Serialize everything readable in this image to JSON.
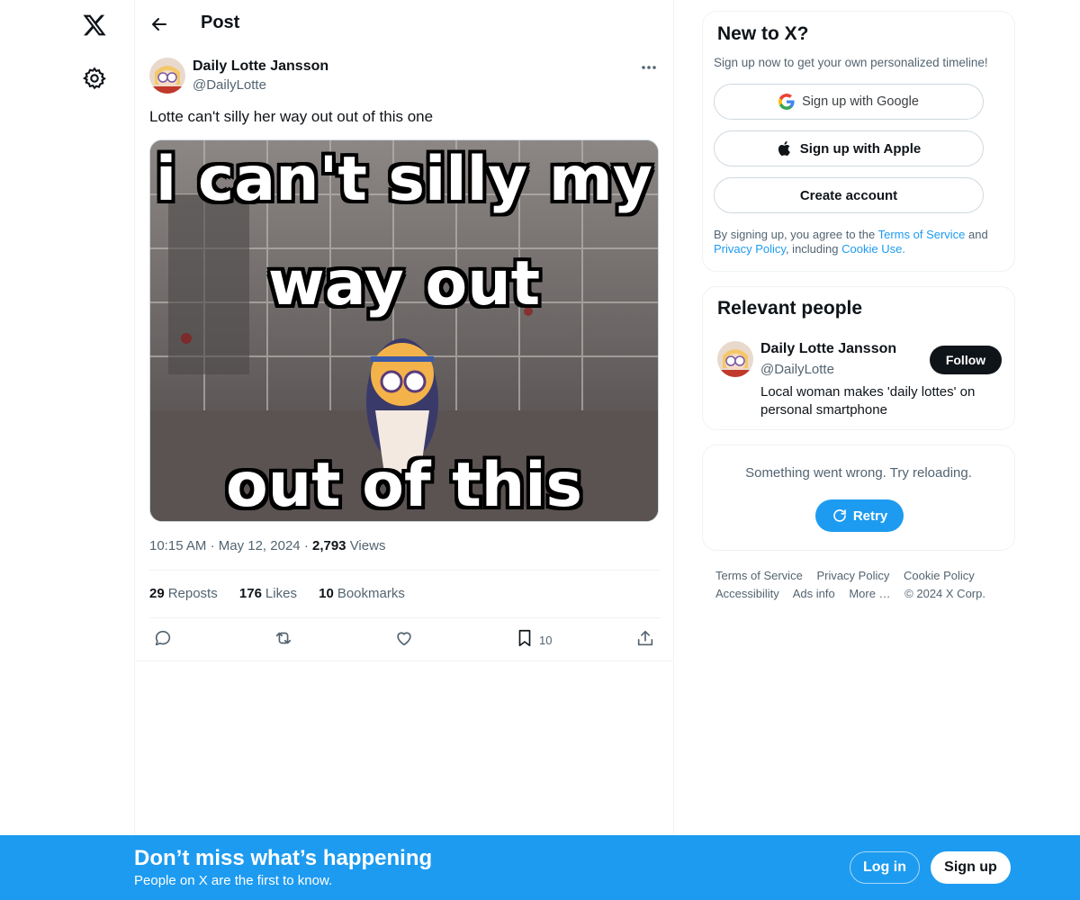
{
  "nav": {
    "logo_icon": "x-logo-icon",
    "settings_icon": "gear-icon"
  },
  "header": {
    "back_icon": "arrow-left-icon",
    "title": "Post"
  },
  "post": {
    "author_name": "Daily Lotte Jansson",
    "author_handle": "@DailyLotte",
    "text": "Lotte can't silly her way out out of this one",
    "media": {
      "caption_line1": "i can't silly my",
      "caption_line2": "way out",
      "caption_line3": "out of this one."
    },
    "time": "10:15 AM",
    "date": "May 12, 2024",
    "views_count": "2,793",
    "views_label": "Views",
    "reposts_count": "29",
    "reposts_label": "Reposts",
    "likes_count": "176",
    "likes_label": "Likes",
    "bookmarks_count": "10",
    "bookmarks_label": "Bookmarks",
    "action_bookmark_count": "10"
  },
  "signup_card": {
    "title": "New to X?",
    "subtitle": "Sign up now to get your own personalized timeline!",
    "google_label": "Sign up with Google",
    "apple_label": "Sign up with Apple",
    "create_label": "Create account",
    "legal_prefix": "By signing up, you agree to the ",
    "terms_link": "Terms of Service",
    "legal_and": " and ",
    "privacy_link": "Privacy Policy",
    "legal_including": ", including ",
    "cookie_link": "Cookie Use."
  },
  "relevant": {
    "title": "Relevant people",
    "name": "Daily Lotte Jansson",
    "handle": "@DailyLotte",
    "follow_label": "Follow",
    "bio": "Local woman makes 'daily lottes' on personal smartphone"
  },
  "trends_error": {
    "message": "Something went wrong. Try reloading.",
    "retry_label": "Retry"
  },
  "footer": {
    "links": [
      "Terms of Service",
      "Privacy Policy",
      "Cookie Policy",
      "Accessibility",
      "Ads info",
      "More …",
      "© 2024 X Corp."
    ]
  },
  "bottom_bar": {
    "title": "Don’t miss what’s happening",
    "subtitle": "People on X are the first to know.",
    "login_label": "Log in",
    "signup_label": "Sign up"
  },
  "colors": {
    "accent": "#1d9bf0",
    "text": "#0f1419",
    "muted": "#536471"
  }
}
